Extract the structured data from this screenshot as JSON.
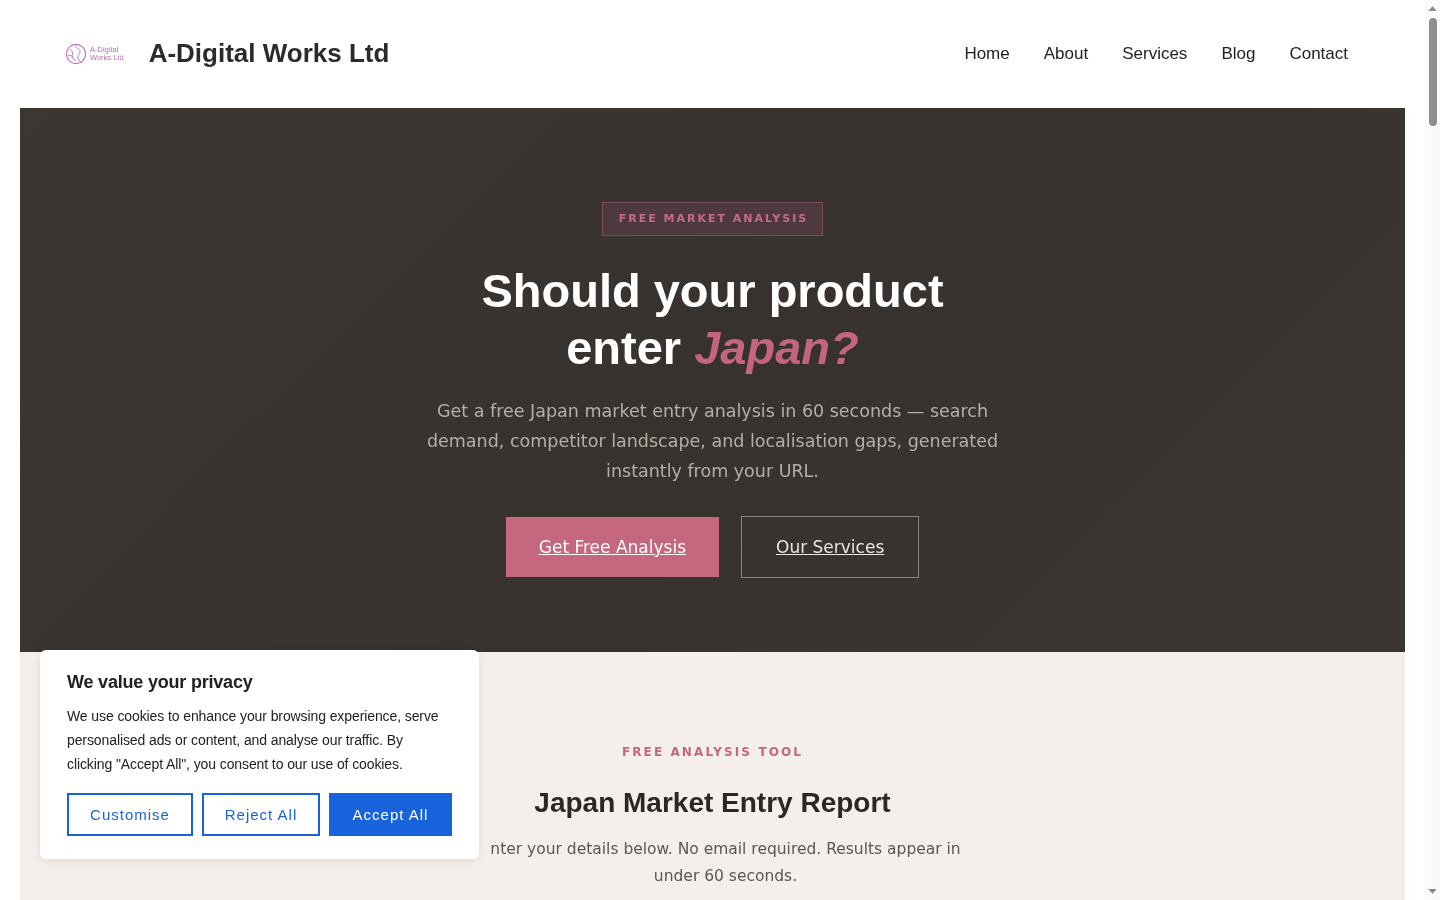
{
  "header": {
    "logo": {
      "lines": [
        "A-Digital",
        "Works Ltd"
      ]
    },
    "site_title": "A-Digital Works Ltd",
    "nav": [
      "Home",
      "About",
      "Services",
      "Blog",
      "Contact"
    ]
  },
  "hero": {
    "badge": "FREE MARKET ANALYSIS",
    "heading": "Should your product enter *Japan?*",
    "description": "Get a free Japan market entry analysis in 60 seconds — search demand, competitor landscape, and localisation gaps, generated instantly from your URL.",
    "buttons": [
      {
        "label": "Get Free Analysis",
        "kind": "primary"
      },
      {
        "label": "Our Services",
        "kind": "outline"
      }
    ]
  },
  "tool_section": {
    "eyebrow": "FREE ANALYSIS TOOL",
    "heading": "Japan Market Entry Report",
    "description": "nter your details below. No email required. Results appear in under 60 seconds."
  },
  "cookie_banner": {
    "title": "We value your privacy",
    "text": "We use cookies to enhance your browsing experience, serve personalised ads or content, and analyse our traffic. By clicking \"Accept All\", you consent to our use of cookies.",
    "buttons": [
      {
        "label": "Customise",
        "kind": "outline"
      },
      {
        "label": "Reject All",
        "kind": "outline"
      },
      {
        "label": "Accept All",
        "kind": "primary"
      }
    ]
  }
}
